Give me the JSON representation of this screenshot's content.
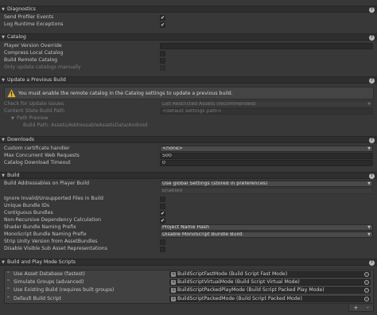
{
  "colors": {
    "background": "#383838",
    "header_bg": "#2e2e2e",
    "field_bg": "#2a2a2a",
    "dropdown_bg": "#4a4a4a",
    "warning_yellow": "#e8b52a",
    "text": "#c4c4c4",
    "disabled_text": "#7d7d7d"
  },
  "icons": {
    "fold": "triangle-down-icon",
    "help": "help-icon",
    "check": "checkmark-icon",
    "warning": "warning-icon",
    "script": "script-icon",
    "picker": "object-picker-icon",
    "add": "plus-icon",
    "remove": "minus-icon"
  },
  "sections": {
    "diagnostics": {
      "title": "Diagnostics",
      "rows": [
        {
          "label": "Send Profiler Events",
          "checked": true
        },
        {
          "label": "Log Runtime Exceptions",
          "checked": true
        }
      ]
    },
    "catalog": {
      "title": "Catalog",
      "rows": [
        {
          "label": "Player Version Override",
          "value": ""
        },
        {
          "label": "Compress Local Catalog",
          "checked": false
        },
        {
          "label": "Build Remote Catalog",
          "checked": false
        },
        {
          "label": "Only update catalogs manually",
          "checked": false
        }
      ]
    },
    "update": {
      "title": "Update a Previous Build",
      "warning": "You must enable the remote catalog in the Catalog settings to update a previous build.",
      "check_label": "Check for Update Issues",
      "check_value": "List Restricted Assets (recommended)",
      "state_label": "Content State Build Path",
      "state_value": "<default settings path>",
      "path_preview_label": "Path Preview",
      "build_path": "Build Path: Assets/AddressableAssetsData/Android"
    },
    "downloads": {
      "title": "Downloads",
      "cert_label": "Custom certificate handler",
      "cert_value": "<none>",
      "max_label": "Max Concurrent Web Requests",
      "max_value": "500",
      "timeout_label": "Catalog Download Timeout",
      "timeout_value": "0"
    },
    "build": {
      "title": "Build",
      "addr_label": "Build Addressables on Player Build",
      "addr_value": "Use global Settings (stored in preferences)",
      "enabled_value": "Enabled",
      "rows": [
        {
          "label": "Ignore Invalid/Unsupported Files in Build",
          "checked": false
        },
        {
          "label": "Unique Bundle IDs",
          "checked": false
        },
        {
          "label": "Contiguous Bundles",
          "checked": true
        },
        {
          "label": "Non-Recursive Dependency Calculation",
          "checked": true
        }
      ],
      "shader_label": "Shader Bundle Naming Prefix",
      "shader_value": "Project Name Hash",
      "mono_label": "MonoScript Bundle Naming Prefix",
      "mono_value": "Disable MonoScript Bundle Build",
      "strip_label": "Strip Unity Version from AssetBundles",
      "strip_checked": false,
      "disable_label": "Disable Visible Sub Asset Representations",
      "disable_checked": false
    },
    "scripts": {
      "title": "Build and Play Mode Scripts",
      "items": [
        {
          "label": "Use Asset Database (fastest)",
          "script": "BuildScriptFastMode (Build Script Fast Mode)"
        },
        {
          "label": "Simulate Groups (advanced)",
          "script": "BuildScriptVirtualMode (Build Script Virtual Mode)"
        },
        {
          "label": "Use Existing Build (requires built groups)",
          "script": "BuildScriptPackedPlayMode (Build Script Packed Play Mode)"
        },
        {
          "label": "Default Build Script",
          "script": "BuildScriptPackedMode (Build Script Packed Mode)"
        }
      ],
      "add": "+",
      "remove": "-"
    }
  }
}
